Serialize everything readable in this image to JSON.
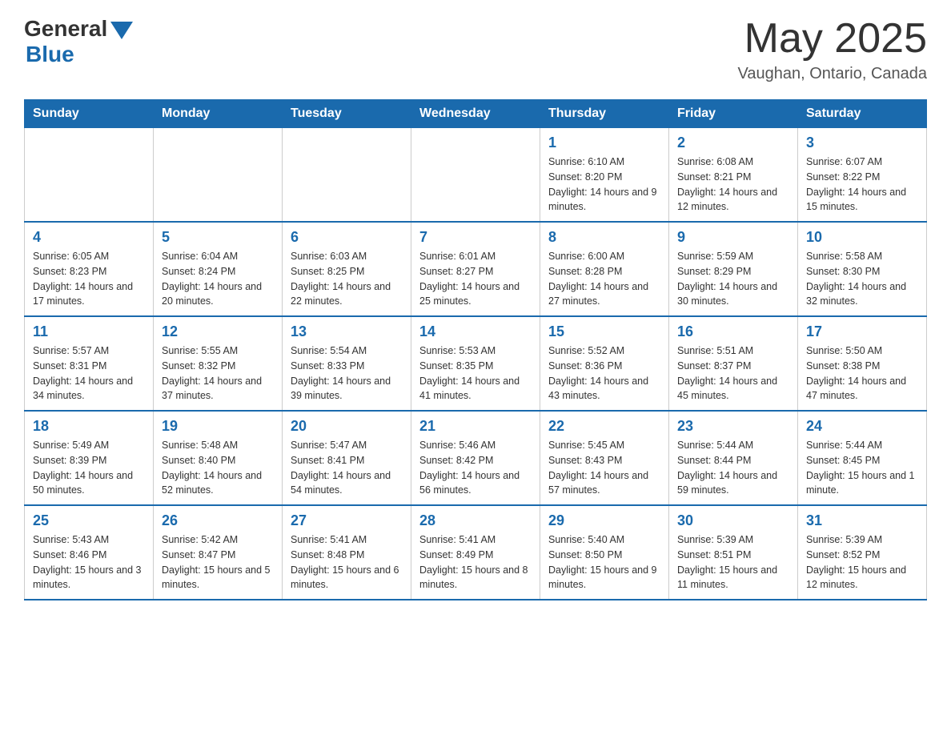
{
  "header": {
    "logo_general": "General",
    "logo_blue": "Blue",
    "month_year": "May 2025",
    "location": "Vaughan, Ontario, Canada"
  },
  "days_of_week": [
    "Sunday",
    "Monday",
    "Tuesday",
    "Wednesday",
    "Thursday",
    "Friday",
    "Saturday"
  ],
  "weeks": [
    [
      {
        "day": "",
        "info": ""
      },
      {
        "day": "",
        "info": ""
      },
      {
        "day": "",
        "info": ""
      },
      {
        "day": "",
        "info": ""
      },
      {
        "day": "1",
        "info": "Sunrise: 6:10 AM\nSunset: 8:20 PM\nDaylight: 14 hours and 9 minutes."
      },
      {
        "day": "2",
        "info": "Sunrise: 6:08 AM\nSunset: 8:21 PM\nDaylight: 14 hours and 12 minutes."
      },
      {
        "day": "3",
        "info": "Sunrise: 6:07 AM\nSunset: 8:22 PM\nDaylight: 14 hours and 15 minutes."
      }
    ],
    [
      {
        "day": "4",
        "info": "Sunrise: 6:05 AM\nSunset: 8:23 PM\nDaylight: 14 hours and 17 minutes."
      },
      {
        "day": "5",
        "info": "Sunrise: 6:04 AM\nSunset: 8:24 PM\nDaylight: 14 hours and 20 minutes."
      },
      {
        "day": "6",
        "info": "Sunrise: 6:03 AM\nSunset: 8:25 PM\nDaylight: 14 hours and 22 minutes."
      },
      {
        "day": "7",
        "info": "Sunrise: 6:01 AM\nSunset: 8:27 PM\nDaylight: 14 hours and 25 minutes."
      },
      {
        "day": "8",
        "info": "Sunrise: 6:00 AM\nSunset: 8:28 PM\nDaylight: 14 hours and 27 minutes."
      },
      {
        "day": "9",
        "info": "Sunrise: 5:59 AM\nSunset: 8:29 PM\nDaylight: 14 hours and 30 minutes."
      },
      {
        "day": "10",
        "info": "Sunrise: 5:58 AM\nSunset: 8:30 PM\nDaylight: 14 hours and 32 minutes."
      }
    ],
    [
      {
        "day": "11",
        "info": "Sunrise: 5:57 AM\nSunset: 8:31 PM\nDaylight: 14 hours and 34 minutes."
      },
      {
        "day": "12",
        "info": "Sunrise: 5:55 AM\nSunset: 8:32 PM\nDaylight: 14 hours and 37 minutes."
      },
      {
        "day": "13",
        "info": "Sunrise: 5:54 AM\nSunset: 8:33 PM\nDaylight: 14 hours and 39 minutes."
      },
      {
        "day": "14",
        "info": "Sunrise: 5:53 AM\nSunset: 8:35 PM\nDaylight: 14 hours and 41 minutes."
      },
      {
        "day": "15",
        "info": "Sunrise: 5:52 AM\nSunset: 8:36 PM\nDaylight: 14 hours and 43 minutes."
      },
      {
        "day": "16",
        "info": "Sunrise: 5:51 AM\nSunset: 8:37 PM\nDaylight: 14 hours and 45 minutes."
      },
      {
        "day": "17",
        "info": "Sunrise: 5:50 AM\nSunset: 8:38 PM\nDaylight: 14 hours and 47 minutes."
      }
    ],
    [
      {
        "day": "18",
        "info": "Sunrise: 5:49 AM\nSunset: 8:39 PM\nDaylight: 14 hours and 50 minutes."
      },
      {
        "day": "19",
        "info": "Sunrise: 5:48 AM\nSunset: 8:40 PM\nDaylight: 14 hours and 52 minutes."
      },
      {
        "day": "20",
        "info": "Sunrise: 5:47 AM\nSunset: 8:41 PM\nDaylight: 14 hours and 54 minutes."
      },
      {
        "day": "21",
        "info": "Sunrise: 5:46 AM\nSunset: 8:42 PM\nDaylight: 14 hours and 56 minutes."
      },
      {
        "day": "22",
        "info": "Sunrise: 5:45 AM\nSunset: 8:43 PM\nDaylight: 14 hours and 57 minutes."
      },
      {
        "day": "23",
        "info": "Sunrise: 5:44 AM\nSunset: 8:44 PM\nDaylight: 14 hours and 59 minutes."
      },
      {
        "day": "24",
        "info": "Sunrise: 5:44 AM\nSunset: 8:45 PM\nDaylight: 15 hours and 1 minute."
      }
    ],
    [
      {
        "day": "25",
        "info": "Sunrise: 5:43 AM\nSunset: 8:46 PM\nDaylight: 15 hours and 3 minutes."
      },
      {
        "day": "26",
        "info": "Sunrise: 5:42 AM\nSunset: 8:47 PM\nDaylight: 15 hours and 5 minutes."
      },
      {
        "day": "27",
        "info": "Sunrise: 5:41 AM\nSunset: 8:48 PM\nDaylight: 15 hours and 6 minutes."
      },
      {
        "day": "28",
        "info": "Sunrise: 5:41 AM\nSunset: 8:49 PM\nDaylight: 15 hours and 8 minutes."
      },
      {
        "day": "29",
        "info": "Sunrise: 5:40 AM\nSunset: 8:50 PM\nDaylight: 15 hours and 9 minutes."
      },
      {
        "day": "30",
        "info": "Sunrise: 5:39 AM\nSunset: 8:51 PM\nDaylight: 15 hours and 11 minutes."
      },
      {
        "day": "31",
        "info": "Sunrise: 5:39 AM\nSunset: 8:52 PM\nDaylight: 15 hours and 12 minutes."
      }
    ]
  ]
}
